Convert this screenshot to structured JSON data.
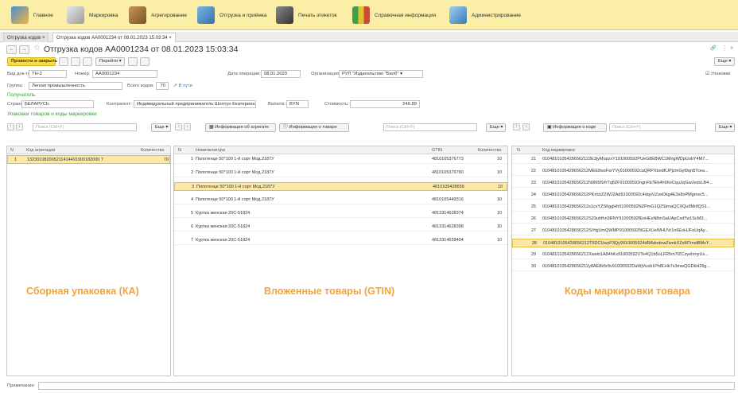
{
  "sections": [
    {
      "label": "Главное"
    },
    {
      "label": "Маркировка"
    },
    {
      "label": "Агрегирование"
    },
    {
      "label": "Отгрузка и приёмка"
    },
    {
      "label": "Печать этикеток"
    },
    {
      "label": "Справочная информация"
    },
    {
      "label": "Администрирование"
    }
  ],
  "tabs": [
    "Отгрузка кодов ×",
    "Отгрузка кодов АА0001234 от 08.01.2023 15:03:34 ×"
  ],
  "doc": {
    "title": "Отгрузка кодов АА0001234 от 08.01.2023 15:03:34",
    "nav_back": "←",
    "nav_fwd": "→",
    "star": "☆",
    "link_icon": "🔗",
    "more": "⋮",
    "close": "×"
  },
  "toolbar": {
    "post_close": "Провести и закрыть",
    "goto": "Перейти ▾",
    "more": "Еще ▾"
  },
  "form": {
    "doc_type_label": "Вид док-та:",
    "doc_type": "ТН-2",
    "number_label": "Номер:",
    "number": "АА0001234",
    "date_label": "Дата операции:",
    "date": "08.01.2023",
    "org_label": "Организация:",
    "org": "РУП \"Издательство \"Белб\" ▾",
    "packages_label": "Упаковки",
    "group_label": "Группа:",
    "group": "Легкая промышленность",
    "total_label": "Всего кодов:",
    "total": "70",
    "in_transit": "В пути",
    "recipient_header": "Получатель",
    "country_label": "Страна:",
    "country": "БЕЛАРУСЬ",
    "counterparty_label": "Контрагент:",
    "counterparty": "Индивидуальный предприниматель Шолтун Екатерина Нико",
    "currency_label": "Валюта:",
    "currency": "BYN",
    "cost_label": "Стоимость:",
    "cost": "246.89",
    "packages_header": "Упаковки товаров и коды маркировки",
    "note_label": "Примечание:"
  },
  "panel1": {
    "search": "Поиск (Ctrl+F)",
    "more": "Еще ▾",
    "cols": [
      "N",
      "Код агрегации",
      "Количество"
    ],
    "rows": [
      {
        "n": "1",
        "code": "132301082005211414491900182000 7",
        "qty": "70"
      }
    ],
    "caption": "Сборная упаковка (КА)"
  },
  "panel2": {
    "agg_info": "Информация об агрегате",
    "item_info": "Информация о товаре",
    "search": "Поиск (Ctrl+F)",
    "more": "Еще ▾",
    "cols": [
      "N",
      "Номенклатура",
      "GTIN",
      "Количество"
    ],
    "rows": [
      {
        "n": "1",
        "name": "Полотенце 50*100 1-й сорт Мод.2187У",
        "gtin": "4810105376773",
        "qty": "10"
      },
      {
        "n": "2",
        "name": "Полотенце 50*100 1-й сорт Мод.2187У",
        "gtin": "4810105376780",
        "qty": "10"
      },
      {
        "n": "3",
        "name": "Полотенце 50*100 1-й сорт Мод.2187У",
        "gtin": "4810105428656",
        "qty": "10"
      },
      {
        "n": "4",
        "name": "Полотенце 50*100 1-й сорт Мод.2187У",
        "gtin": "4810105449316",
        "qty": "10"
      },
      {
        "n": "5",
        "name": "Куртка женская 20С-51824",
        "gtin": "4813314628374",
        "qty": "10"
      },
      {
        "n": "6",
        "name": "Куртка женская 20С-51824",
        "gtin": "4813314628398",
        "qty": "10"
      },
      {
        "n": "7",
        "name": "Куртка женская 20С-51824",
        "gtin": "4813314628404",
        "qty": "10"
      }
    ],
    "caption": "Вложенные товары (GTIN)"
  },
  "panel3": {
    "code_info": "Информация о коде",
    "search": "Поиск (Ctrl+F)",
    "more": "Еще ▾",
    "cols": [
      "N",
      "Код маркировки"
    ],
    "rows": [
      {
        "n": "21",
        "code": "0104810105428656​2122E3jyMopzxY191000592PUeG8EBWC1MngWDpUobY4M7..."
      },
      {
        "n": "22",
        "code": "010481010542865621​2MEE8wsFsrYVy91000592caQRPXbodKJPjzmGyt9qn87cea..."
      },
      {
        "n": "23",
        "code": "010481010542865621​2N9M9SrhTq8ZF91000592ngnFb7Eb4h9hoCquJzjGwJedxLB4..."
      },
      {
        "n": "24",
        "code": "010481010542865621​2PKmziZZWJ2Ad91000592c4dqoVZoeDkg4E3x8oPMgmxc5..."
      },
      {
        "n": "25",
        "code": "010481010542865621​2s1cxYZS6ggHh91000592NZPmG1Q2StrnaQCXQu9MrifQS1..."
      },
      {
        "n": "26",
        "code": "010481010542865621​2S29uhfhn3RNY91000592fEoHEsN8mSaUApCxdTw1ScM3..."
      },
      {
        "n": "27",
        "code": "010481010542865621​2SiYqjUmQWMP91000592NGEXUeWHUVr1n6EoHJFoUqAy..."
      },
      {
        "n": "28",
        "code": "010481010542865621​2T5DCUwzP3Qy9910005924dRAdndowZwnkXZxM7mxtBMxY..."
      },
      {
        "n": "29",
        "code": "010481010542865621​2Xwxkt1A84hKx91000592VTe4Q1b5oLFR5m7fZCzyehmyUs..."
      },
      {
        "n": "30",
        "code": "010481010542865621​2y8AE8k5r8v91000592DaWjVusb1Ph8LHk7x3mwQGDkH26g..."
      }
    ],
    "caption": "Коды маркировки товара"
  },
  "colors": {
    "topbar": "#fbeea6",
    "selected": "#fce9a8",
    "accent": "#f8dc3e",
    "caption": "#f2a33a",
    "green": "#3c9b3c"
  }
}
